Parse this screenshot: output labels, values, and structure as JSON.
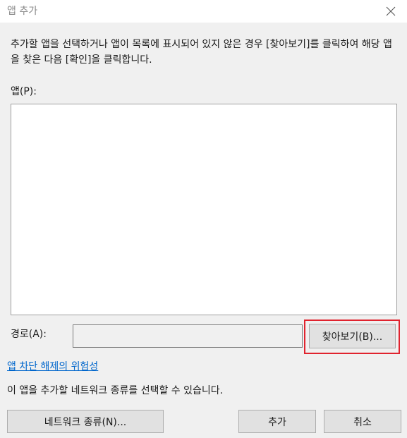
{
  "window": {
    "title": "앱 추가",
    "close_icon": "close-icon"
  },
  "dialog": {
    "instruction": "추가할 앱을 선택하거나 앱이 목록에 표시되어 있지 않은 경우 [찾아보기]를 클릭하여 해당 앱을 찾은 다음 [확인]을 클릭합니다.",
    "apps_label": "앱(P):",
    "apps_items": [],
    "path_label": "경로(A):",
    "path_value": "",
    "browse_label": "찾아보기(B)...",
    "risk_link": "앱 차단 해제의 위험성",
    "network_desc": "이 앱을 추가할 네트워크 종류를 선택할 수 있습니다.",
    "network_types_label": "네트워크 종류(N)...",
    "add_label": "추가",
    "cancel_label": "취소"
  },
  "colors": {
    "dialog_bg": "#f0f0f0",
    "link": "#0066cc",
    "highlight": "#e0232e",
    "button_bg": "#e1e1e1"
  }
}
